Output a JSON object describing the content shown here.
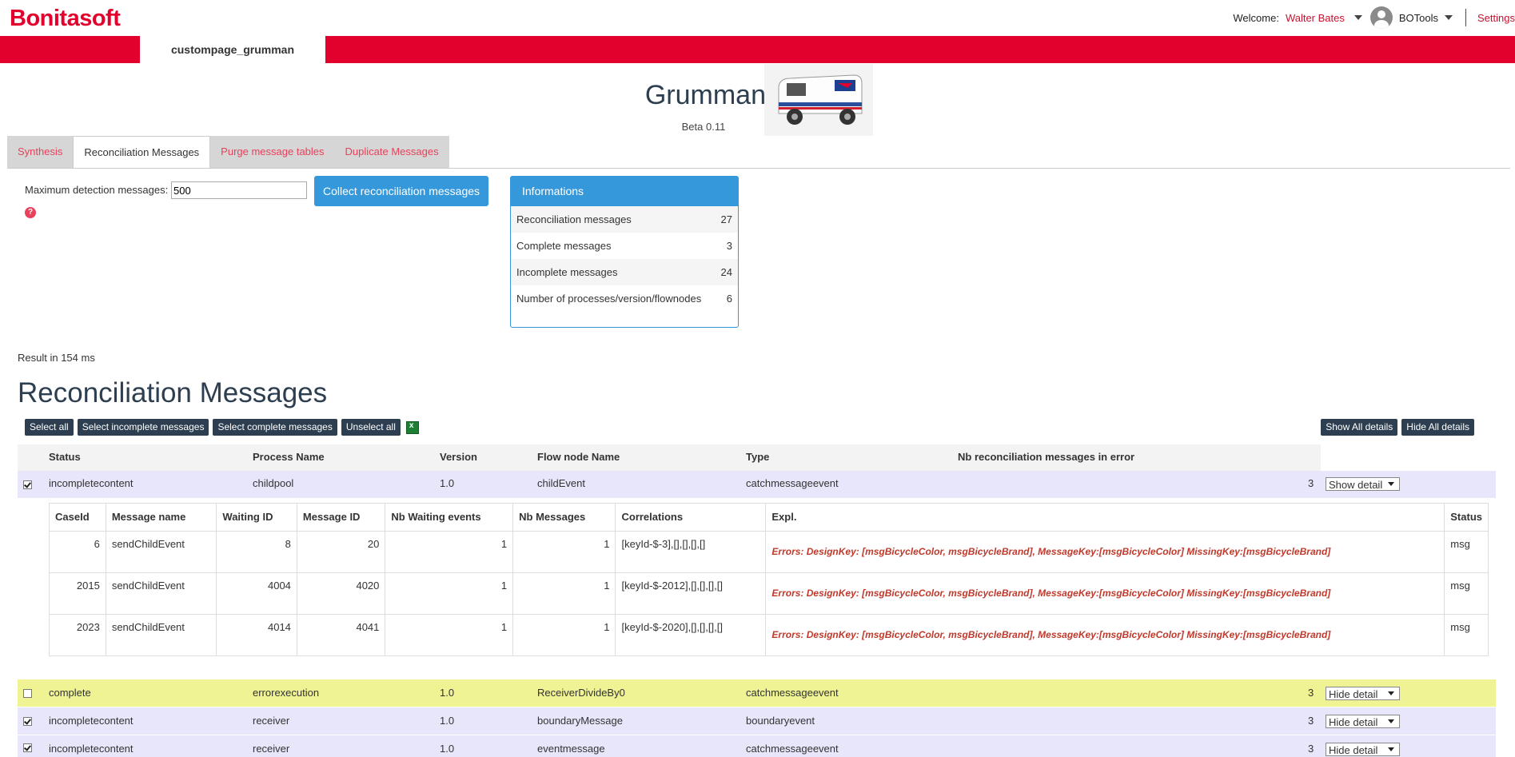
{
  "app": {
    "logo": "Bonitasoft",
    "welcome_label": "Welcome:",
    "user_name": "Walter Bates",
    "profile": "BOTools",
    "settings": "Settings",
    "page_tab": "custompage_grumman"
  },
  "header": {
    "title": "Grumman",
    "version": "Beta 0.11"
  },
  "tabs": [
    {
      "label": "Synthesis",
      "active": false
    },
    {
      "label": "Reconciliation Messages",
      "active": true
    },
    {
      "label": "Purge message tables",
      "active": false
    },
    {
      "label": "Duplicate Messages",
      "active": false
    }
  ],
  "form": {
    "max_label": "Maximum detection messages:",
    "max_value": "500",
    "help_icon": "?",
    "collect_button": "Collect reconciliation messages"
  },
  "info": {
    "title": "Informations",
    "rows": [
      {
        "label": "Reconciliation messages",
        "value": "27"
      },
      {
        "label": "Complete messages",
        "value": "3"
      },
      {
        "label": "Incomplete messages",
        "value": "24"
      },
      {
        "label": "Number of processes/version/flownodes",
        "value": "6"
      }
    ]
  },
  "result": "Result in 154 ms",
  "section_title": "Reconciliation Messages",
  "buttons": {
    "select_all": "Select all",
    "select_incomplete": "Select incomplete messages",
    "select_complete": "Select complete messages",
    "unselect_all": "Unselect all",
    "show_all": "Show All details",
    "hide_all": "Hide All details"
  },
  "table": {
    "headers": [
      "Status",
      "Process Name",
      "Version",
      "Flow node Name",
      "Type",
      "Nb reconciliation messages in error"
    ],
    "rows": [
      {
        "checked": true,
        "status": "incompletecontent",
        "process": "childpool",
        "version": "1.0",
        "flownode": "childEvent",
        "type": "catchmessageevent",
        "nb": "3",
        "action": "Show detail",
        "color": "#e8e6fb"
      },
      {
        "checked": false,
        "status": "complete",
        "process": "errorexecution",
        "version": "1.0",
        "flownode": "ReceiverDivideBy0",
        "type": "catchmessageevent",
        "nb": "3",
        "action": "Hide detail",
        "color": "#eff394"
      },
      {
        "checked": true,
        "status": "incompletecontent",
        "process": "receiver",
        "version": "1.0",
        "flownode": "boundaryMessage",
        "type": "boundaryevent",
        "nb": "3",
        "action": "Hide detail",
        "color": "#e8e6fb"
      },
      {
        "checked": true,
        "status": "incompletecontent",
        "process": "receiver",
        "version": "1.0",
        "flownode": "eventmessage",
        "type": "catchmessageevent",
        "nb": "3",
        "action": "Hide detail",
        "color": "#e8e6fb"
      }
    ]
  },
  "detail": {
    "headers": [
      "CaseId",
      "Message name",
      "Waiting ID",
      "Message ID",
      "Nb Waiting events",
      "Nb Messages",
      "Correlations",
      "Expl.",
      "Status"
    ],
    "rows": [
      {
        "caseid": "6",
        "msgname": "sendChildEvent",
        "waiting": "8",
        "message": "20",
        "nbwait": "1",
        "nbmsg": "1",
        "corr": "[keyId-$-3],[],[],[],[]",
        "expl": "Errors: DesignKey: [msgBicycleColor, msgBicycleBrand], MessageKey:[msgBicycleColor] MissingKey:[msgBicycleBrand]",
        "status": "msg"
      },
      {
        "caseid": "2015",
        "msgname": "sendChildEvent",
        "waiting": "4004",
        "message": "4020",
        "nbwait": "1",
        "nbmsg": "1",
        "corr": "[keyId-$-2012],[],[],[],[]",
        "expl": "Errors: DesignKey: [msgBicycleColor, msgBicycleBrand], MessageKey:[msgBicycleColor] MissingKey:[msgBicycleBrand]",
        "status": "msg"
      },
      {
        "caseid": "2023",
        "msgname": "sendChildEvent",
        "waiting": "4014",
        "message": "4041",
        "nbwait": "1",
        "nbmsg": "1",
        "corr": "[keyId-$-2020],[],[],[],[]",
        "expl": "Errors: DesignKey: [msgBicycleColor, msgBicycleBrand], MessageKey:[msgBicycleColor] MissingKey:[msgBicycleBrand]",
        "status": "msg"
      }
    ]
  },
  "colors": {
    "brand": "#e2002d",
    "accent": "#3498db",
    "dark_button": "#2c3e50",
    "link": "#e8415b"
  }
}
